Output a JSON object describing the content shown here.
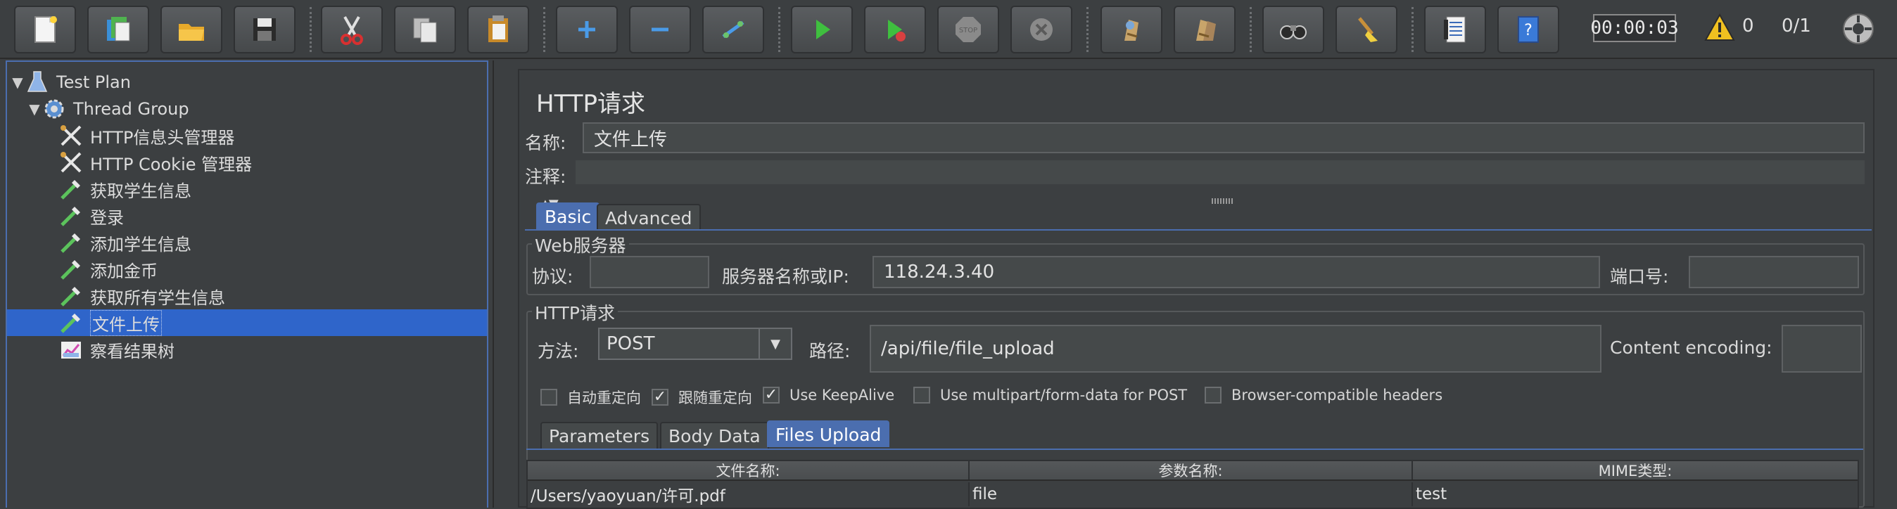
{
  "toolbar": {
    "timer": "00:00:03",
    "warning_count": "0",
    "thread_count": "0/1",
    "icons": [
      "new-icon",
      "templates-icon",
      "open-icon",
      "save-icon",
      "cut-icon",
      "copy-icon",
      "paste-icon",
      "expand-icon",
      "collapse-icon",
      "toggle-icon",
      "start-icon",
      "start-no-pause-icon",
      "stop-icon",
      "shutdown-icon",
      "clear-icon",
      "clear-all-icon",
      "search-icon",
      "reset-search-icon",
      "function-helper-icon",
      "help-icon"
    ]
  },
  "tree": {
    "items": [
      {
        "label": "Test Plan",
        "icon": "test-plan-icon"
      },
      {
        "label": "Thread Group",
        "icon": "thread-group-icon"
      },
      {
        "label": "HTTP信息头管理器",
        "icon": "config-icon"
      },
      {
        "label": "HTTP Cookie 管理器",
        "icon": "config-icon"
      },
      {
        "label": "获取学生信息",
        "icon": "sampler-icon"
      },
      {
        "label": "登录",
        "icon": "sampler-icon"
      },
      {
        "label": "添加学生信息",
        "icon": "sampler-icon"
      },
      {
        "label": "添加金币",
        "icon": "sampler-icon"
      },
      {
        "label": "获取所有学生信息",
        "icon": "sampler-icon"
      },
      {
        "label": "文件上传",
        "icon": "sampler-icon"
      },
      {
        "label": "察看结果树",
        "icon": "listener-icon"
      }
    ],
    "selected_index": 9
  },
  "panel": {
    "title": "HTTP请求",
    "name_label": "名称:",
    "name_value": "文件上传",
    "comment_label": "注释:",
    "tabs": [
      "Basic",
      "Advanced"
    ],
    "web_server": {
      "title": "Web服务器",
      "protocol_label": "协议:",
      "protocol_value": "",
      "server_label": "服务器名称或IP:",
      "server_value": "118.24.3.40",
      "port_label": "端口号:",
      "port_value": ""
    },
    "http_request": {
      "title": "HTTP请求",
      "method_label": "方法:",
      "method_value": "POST",
      "path_label": "路径:",
      "path_value": "/api/file/file_upload",
      "encoding_label": "Content encoding:",
      "encoding_value": ""
    },
    "checkboxes": [
      {
        "label": "自动重定向",
        "checked": false
      },
      {
        "label": "跟随重定向",
        "checked": true
      },
      {
        "label": "Use KeepAlive",
        "checked": true
      },
      {
        "label": "Use multipart/form-data for POST",
        "checked": false
      },
      {
        "label": "Browser-compatible headers",
        "checked": false
      }
    ],
    "sub_tabs": [
      "Parameters",
      "Body Data",
      "Files Upload"
    ],
    "files_table": {
      "headers": [
        "文件名称:",
        "参数名称:",
        "MIME类型:"
      ],
      "rows": [
        [
          "/Users/yaoyuan/许可.pdf",
          "file",
          "test"
        ]
      ]
    }
  }
}
